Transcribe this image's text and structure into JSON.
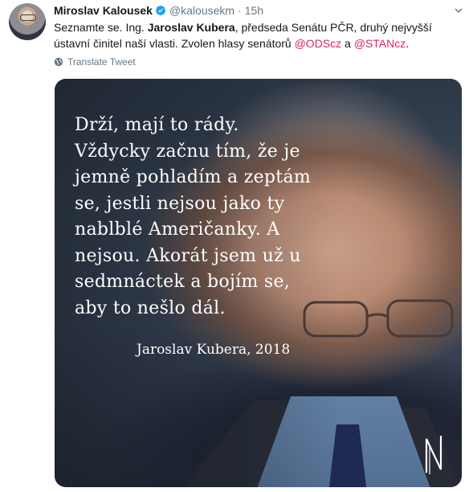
{
  "tweet": {
    "display_name": "Miroslav Kalousek",
    "handle": "@kalousekm",
    "separator": "·",
    "time": "15h",
    "text": {
      "part1": "Seznamte se. Ing. ",
      "bold_name": "Jaroslav Kubera",
      "part2": ", předseda Senátu PČR,  druhý nejvyšší ústavní činitel naší vlasti. Zvolen hlasy senátorů  ",
      "mention1": "@ODScz",
      "part3": " a ",
      "mention2": "@STANcz",
      "part4": "."
    },
    "translate_label": "Translate Tweet"
  },
  "media": {
    "quote_lines": [
      "Drží, mají to rády.",
      "Vždycky začnu tím, že je",
      "jemně pohladím a zeptám",
      "se, jestli nejsou jako ty",
      "nablblé Američanky. A",
      "nejsou. Akorát jsem už u",
      "sedmnáctek a bojím se,",
      "aby to nešlo dál."
    ],
    "author": "Jaroslav Kubera, 2018"
  },
  "icons": {
    "verified": "verified-badge-icon",
    "caret": "chevron-down-icon",
    "globe": "globe-icon",
    "logo": "n-logo-icon"
  },
  "colors": {
    "link": "#e0245e",
    "verified": "#1da1f2",
    "muted": "#657786",
    "text": "#14171a"
  }
}
